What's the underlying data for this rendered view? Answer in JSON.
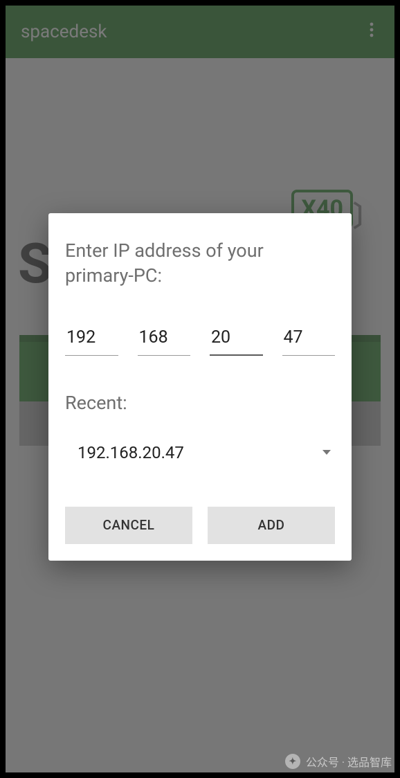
{
  "header": {
    "title": "spacedesk",
    "menu_icon": "more-vert"
  },
  "background": {
    "logo_text": "X40",
    "big_letter": "S"
  },
  "dialog": {
    "title": "Enter IP address of your primary-PC:",
    "ip": {
      "oct1": "192",
      "oct2": "168",
      "oct3": "20",
      "oct4": "47"
    },
    "recent_label": "Recent:",
    "recent_value": "192.168.20.47",
    "cancel_label": "CANCEL",
    "add_label": "ADD"
  },
  "watermark": {
    "text": "公众号 · 选品智库"
  }
}
